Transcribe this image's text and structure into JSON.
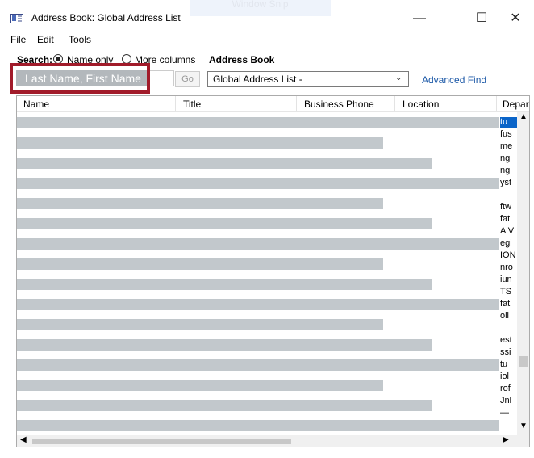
{
  "window": {
    "title": "Address Book: Global Address List",
    "snip_label": "Window Snip",
    "minimize": "—",
    "maximize": "☐",
    "close": "✕"
  },
  "menu": [
    "File",
    "Edit",
    "Tools"
  ],
  "search": {
    "label": "Search:",
    "option_name_only": "Name only",
    "option_more_columns": "More columns",
    "selected_option": "Name only",
    "input_placeholder": "Last Name, First Name",
    "go_label": "Go"
  },
  "address_book": {
    "label": "Address Book",
    "selected": "Global Address List -",
    "advanced_find": "Advanced Find"
  },
  "results": {
    "columns": [
      "Name",
      "Title",
      "Business Phone",
      "Location",
      "Depar"
    ],
    "dept_fragments": [
      "tu",
      "fus",
      "me",
      "ng",
      "ng",
      "yst",
      "",
      "ftw",
      "fat",
      "A V",
      "egi",
      "ION",
      "nro",
      "iun",
      "TS",
      "fat",
      "oli",
      "",
      "est",
      "ssi",
      "tu",
      "iol",
      "rof",
      "Jnl",
      "—"
    ],
    "selected_row_index": 0
  },
  "colors": {
    "highlight_border": "#a11b2a",
    "placeholder_fill": "#b3b8bc",
    "redaction_bar": "#c2c8cc",
    "link": "#1e5aa8",
    "selection": "#0a64c8"
  }
}
